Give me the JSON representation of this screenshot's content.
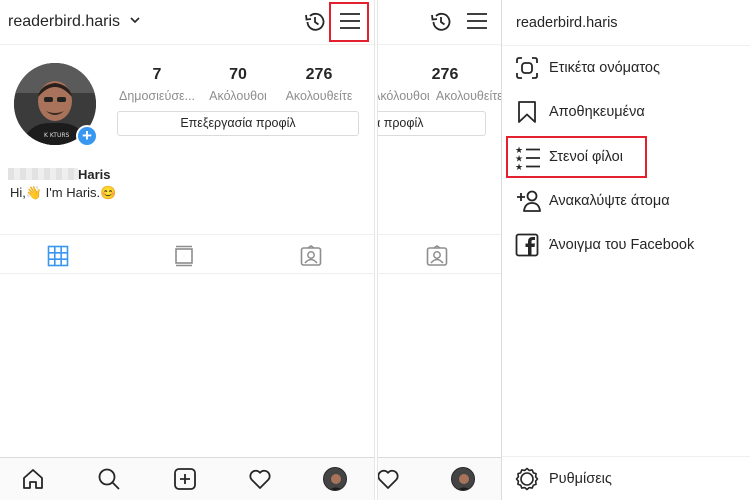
{
  "profile": {
    "username": "readerbird.haris",
    "name": "Haris",
    "bio": "Hi,👋 I'm Haris.😊",
    "stats": [
      {
        "value": "7",
        "label": "Δημοσιεύσε..."
      },
      {
        "value": "70",
        "label": "Ακόλουθοι"
      },
      {
        "value": "276",
        "label": "Ακολουθείτε"
      }
    ],
    "edit_button": "Επεξεργασία προφίλ"
  },
  "middle_panel": {
    "stat_value": "276",
    "stat_labels": "Ακόλουθοι  Ακολουθείτε",
    "edit_button_partial": "α προφίλ"
  },
  "drawer": {
    "username": "readerbird.haris",
    "items": [
      {
        "label": "Ετικέτα ονόματος",
        "icon": "nametag-icon"
      },
      {
        "label": "Αποθηκευμένα",
        "icon": "bookmark-icon"
      },
      {
        "label": "Στενοί φίλοι",
        "icon": "close-friends-icon"
      },
      {
        "label": "Ανακαλύψτε άτομα",
        "icon": "discover-people-icon"
      },
      {
        "label": "Άνοιγμα του Facebook",
        "icon": "facebook-icon"
      }
    ],
    "settings": "Ρυθμίσεις"
  },
  "colors": {
    "highlight": "#e5202e",
    "accent_blue": "#3897f0",
    "text": "#262626",
    "secondary_text": "#8e8e8e"
  }
}
